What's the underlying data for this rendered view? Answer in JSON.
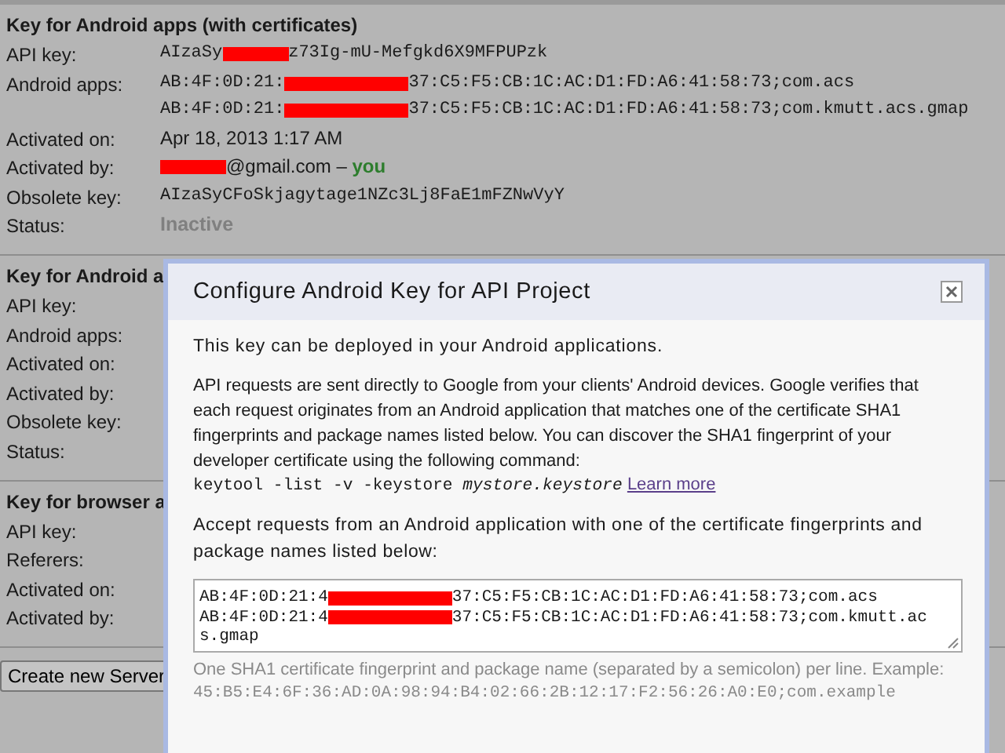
{
  "sections": [
    {
      "title": "Key for Android apps (with certificates)",
      "rows": [
        {
          "label": "API key:",
          "kind": "mono",
          "lines": [
            [
              {
                "kind": "text",
                "text": "AIzaSy"
              },
              {
                "kind": "redaction"
              },
              {
                "kind": "text",
                "text": "z73Ig-mU-Mefgkd6X9MFPUPzk"
              }
            ]
          ]
        },
        {
          "label": "Android apps:",
          "kind": "mono",
          "lines": [
            [
              {
                "kind": "text",
                "text": "AB:4F:0D:21:"
              },
              {
                "kind": "wide_redaction"
              },
              {
                "kind": "text",
                "text": "37:C5:F5:CB:1C:AC:D1:FD:A6:41:58:73;com.acs"
              }
            ],
            [
              {
                "kind": "text",
                "text": "AB:4F:0D:21:"
              },
              {
                "kind": "wide_redaction"
              },
              {
                "kind": "text",
                "text": "37:C5:F5:CB:1C:AC:D1:FD:A6:41:58:73;com.kmutt.acs.gmap"
              }
            ]
          ]
        },
        {
          "label": "Activated on:",
          "kind": "plain",
          "lines": [
            [
              {
                "kind": "text",
                "text": "Apr 18, 2013 1:17 AM"
              }
            ]
          ]
        },
        {
          "label": "Activated by:",
          "kind": "plain",
          "lines": [
            [
              {
                "kind": "redaction"
              },
              {
                "kind": "text",
                "text": "@gmail.com – "
              },
              {
                "kind": "highlight",
                "text": "you"
              }
            ]
          ]
        },
        {
          "label": "Obsolete key:",
          "kind": "mono",
          "lines": [
            [
              {
                "kind": "text",
                "text": "AIzaSyCFoSkjagytage1NZc3Lj8FaE1mFZNwVyY"
              }
            ]
          ]
        },
        {
          "label": "Status:",
          "kind": "status",
          "lines": [
            [
              {
                "kind": "text",
                "text": "Inactive"
              }
            ]
          ]
        }
      ]
    },
    {
      "title": "Key for Android a",
      "rows": [
        {
          "label": "API key:"
        },
        {
          "label": "Android apps:"
        },
        {
          "label": "Activated on:"
        },
        {
          "label": "Activated by:"
        },
        {
          "label": "Obsolete key:"
        },
        {
          "label": "Status:"
        }
      ]
    },
    {
      "title": "Key for browser a",
      "rows": [
        {
          "label": "API key:"
        },
        {
          "label": "Referers:"
        },
        {
          "label": "Activated on:"
        },
        {
          "label": "Activated by:"
        }
      ]
    }
  ],
  "create_button": "Create new Server",
  "dialog": {
    "title": "Configure Android Key for API Project",
    "intro": "This key can be deployed in your Android applications.",
    "description": "API requests are sent directly to Google from your clients' Android devices. Google verifies that each request originates from an Android application that matches one of the certificate SHA1 fingerprints and package names listed below. You can discover the SHA1 fingerprint of your developer certificate using the following command:",
    "command": "keytool -list -v -keystore *mystore.keystore*",
    "link": "Learn more",
    "accept_label": "Accept requests from an Android application with one of the certificate fingerprints and package names listed below:",
    "textarea_lines": [
      [
        {
          "kind": "text",
          "text": "AB:4F:0D:21:4"
        },
        {
          "kind": "wide_redaction"
        },
        {
          "kind": "text",
          "text": "37:C5:F5:CB:1C:AC:D1:FD:A6:41:58:73;com.acs"
        }
      ],
      [
        {
          "kind": "text",
          "text": "AB:4F:0D:21:4"
        },
        {
          "kind": "wide_redaction"
        },
        {
          "kind": "text",
          "text": "37:C5:F5:CB:1C:AC:D1:FD:A6:41:58:73;com.kmutt.ac"
        }
      ],
      [
        {
          "kind": "text",
          "text": "s.gmap"
        }
      ]
    ],
    "hint": "One SHA1 certificate fingerprint and package name (separated by a semicolon) per line. Example:",
    "example": "45:B5:E4:6F:36:AD:0A:98:94:B4:02:66:2B:12:17:F2:56:26:A0:E0;com.example"
  }
}
